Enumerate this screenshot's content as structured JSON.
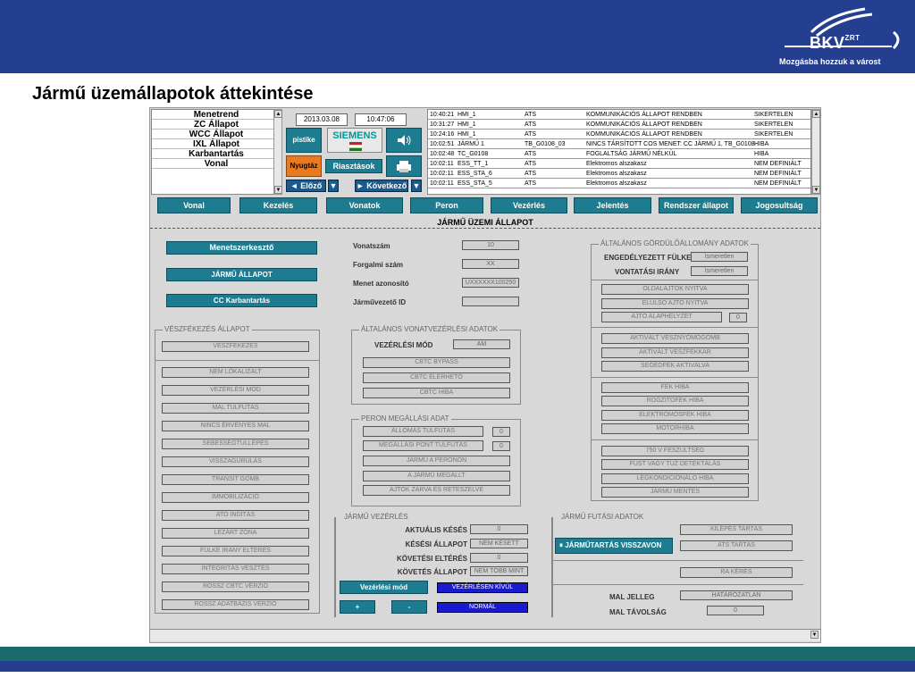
{
  "header": {
    "logo": "BKV",
    "logo_sup": "ZRT",
    "tagline": "Mozgásba hozzuk a várost"
  },
  "slide_title": "Jármű üzemállapotok áttekintése",
  "menu": [
    "Menetrend",
    "ZC Állapot",
    "WCC Állapot",
    "IXL Állapot",
    "Karbantartás",
    "Vonal"
  ],
  "datetime": {
    "date": "2013.03.08",
    "time": "10:47:06"
  },
  "toolbar": {
    "pisztike": "pistike",
    "siemens": "SIEMENS",
    "nyugtaz": "Nyugtáz",
    "riasztasok": "Riasztások",
    "elozo": "Előző",
    "kovetkezo": "Következő"
  },
  "alarms": [
    [
      "10:40:21",
      "HMI_1",
      "ATS",
      "KOMMUNIKÁCIÓS ÁLLAPOT RENDBEN",
      "SIKERTELEN"
    ],
    [
      "10:31:27",
      "HMI_1",
      "ATS",
      "KOMMUNIKÁCIÓS ÁLLAPOT RENDBEN",
      "SIKERTELEN"
    ],
    [
      "10:24:16",
      "HMI_1",
      "ATS",
      "KOMMUNIKÁCIÓS ÁLLAPOT RENDBEN",
      "SIKERTELEN"
    ],
    [
      "10:02:51",
      "JÁRMŰ 1",
      "TB_G0108_03",
      "NINCS TÁRSÍTOTT COS MENET: CC JÁRMŰ 1, TB_G0108",
      "HIBA"
    ],
    [
      "10:02:48",
      "TC_G0108",
      "ATS",
      "FOGLALTSÁG JÁRMŰ NÉLKÜL",
      "HIBA"
    ],
    [
      "10:02:11",
      "ESS_TT_1",
      "ATS",
      "Elektromos alszakasz",
      "NEM DEFINIÁLT"
    ],
    [
      "10:02:11",
      "ESS_STA_6",
      "ATS",
      "Elektromos alszakasz",
      "NEM DEFINIÁLT"
    ],
    [
      "10:02:11",
      "ESS_STA_5",
      "ATS",
      "Elektromos alszakasz",
      "NEM DEFINIÁLT"
    ]
  ],
  "nav": [
    "Vonal",
    "Kezelés",
    "Vonatok",
    "Peron",
    "Vezérlés",
    "Jelentés",
    "Rendszer állapot",
    "Jogosultság"
  ],
  "section_title": "JÁRMŰ ÜZEMI ÁLLAPOT",
  "left_buttons": [
    "Menetszerkesztő",
    "JÁRMŰ ÁLLAPOT",
    "CC Karbantartás"
  ],
  "train_info": {
    "vonatszam_label": "Vonatszám",
    "vonatszam": "10",
    "forgalmi_label": "Forgalmi szám",
    "forgalmi": "XX",
    "menet_label": "Menet azonosító",
    "menet": "UXXXXXX100250",
    "jarmuvezeto_label": "Járművezető ID",
    "jarmuvezeto": ""
  },
  "vesz": {
    "title": "VÉSZFÉKEZÉS ÁLLAPOT",
    "first": "VÉSZFÉKEZÉS",
    "items": [
      "NEM LOKALIZÁLT",
      "VEZÉRLÉSI MÓD",
      "MAL TÚLFUTÁS",
      "NINCS ÉRVÉNYES MAL",
      "SEBESSÉGTÚLLÉPÉS",
      "VISSZAGURULÁS",
      "TRANSIT GOMB",
      "IMMOBILIZÁCIÓ",
      "ATO INDÍTÁS",
      "LEZÁRT ZÓNA",
      "FÜLKE IRÁNY ELTÉRÉS",
      "INTEGRITÁS VESZTÉS",
      "ROSSZ CBTC VERZIÓ",
      "ROSSZ ADATBÁZIS VERZIÓ"
    ]
  },
  "altalanos_vonat": {
    "title": "ÁLTALÁNOS VONATVEZÉRLÉSI ADATOK",
    "mod_label": "VEZÉRLÉSI MÓD",
    "mod_value": "AM",
    "items": [
      "CBTC BYPASS",
      "CBTC ELÉRHETŐ",
      "CBTC HIBA"
    ]
  },
  "peron": {
    "title": "PERON MEGÁLLÁSI ADAT",
    "rows": [
      {
        "label": "ÁLLOMÁS TÚLFUTÁS",
        "value": "0"
      },
      {
        "label": "MEGÁLLÁSI PONT TÚLFUTÁS",
        "value": "0"
      }
    ],
    "items": [
      "JÁRMŰ A PERONON",
      "A JÁRMŰ MEGÁLLT",
      "AJTÓK ZÁRVA ÉS RETESZELVE"
    ]
  },
  "gordulo": {
    "title": "ÁLTALÁNOS GÖRDÜLŐÁLLOMÁNY ADATOK",
    "fulke_label": "ENGEDÉLYEZETT FÜLKE",
    "fulke_value": "Ismeretlen",
    "irany_label": "VONTATÁSI IRÁNY",
    "irany_value": "Ismeretlen",
    "ajto": [
      "OLDALAJTÓK NYITVA",
      "ELÜLSŐ AJTÓ NYITVA"
    ],
    "alaphelyzet_label": "AJTÓ ALAPHELYZET",
    "alaphelyzet_value": "0",
    "aktiv": [
      "AKTIVÁLT VÉSZNYOMÓGOMB",
      "AKTIVÁLT VÉSZFÉKKAR",
      "SEGÉDFÉK AKTIVÁLVA"
    ],
    "fek": [
      "FÉK HIBA",
      "RÖGZÍTŐFÉK HIBA",
      "ELEKTROMOSFÉK HIBA",
      "MOTORHIBA"
    ],
    "egyeb": [
      "750 V FESZÜLTSÉG",
      "FÜST VAGY TŰZ DETEKTÁLÁS",
      "LÉGKONDICIONÁLÓ HIBA",
      "JÁRMŰ MENTÉS"
    ]
  },
  "jarmu_vezetes": {
    "title": "JÁRMŰ VEZÉRLÉS",
    "rows": [
      {
        "label": "AKTUÁLIS KÉSÉS",
        "value": "0"
      },
      {
        "label": "KÉSÉSI ÁLLAPOT",
        "value": "NEM KÉSETT"
      },
      {
        "label": "KÖVETÉSI ELTÉRÉS",
        "value": "0"
      },
      {
        "label": "KÖVETÉS ÁLLAPOT",
        "value": "NEM TÖBB MINT"
      }
    ],
    "mod_btn": "Vezérlési mód",
    "mod_status": "VEZÉRLÉSEN KÍVÜL",
    "plus": "+",
    "minus": "-",
    "normal": "NORMÁL"
  },
  "futasi": {
    "title": "JÁRMŰ FUTÁSI ADATOK",
    "btn": "JÁRMŰTARTÁS VISSZAVON",
    "items": [
      "KILÉPÉS TARTÁS",
      "ATS TARTÁS",
      "RA KÉRÉS"
    ],
    "mal_jelleg_label": "MAL JELLEG",
    "mal_jelleg": "HATÁROZATLAN",
    "mal_tav_label": "MAL TÁVOLSÁG",
    "mal_tav": "0"
  },
  "colors": {
    "banner": "#243f8f",
    "teal": "#1d7c8f",
    "panel": "#d8d8d8"
  }
}
